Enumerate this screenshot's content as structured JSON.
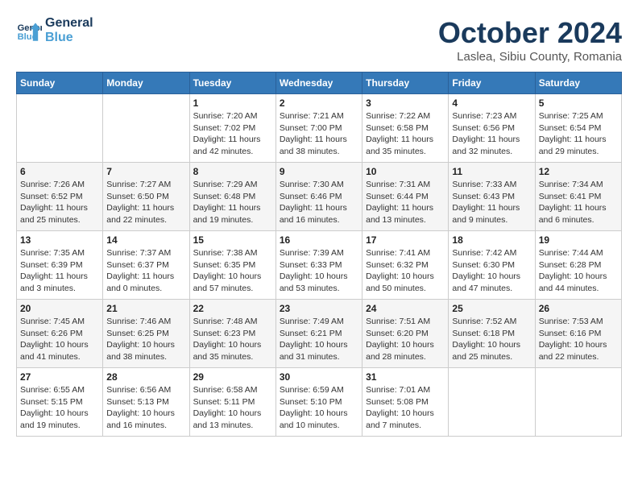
{
  "header": {
    "logo_line1": "General",
    "logo_line2": "Blue",
    "month": "October 2024",
    "location": "Laslea, Sibiu County, Romania"
  },
  "weekdays": [
    "Sunday",
    "Monday",
    "Tuesday",
    "Wednesday",
    "Thursday",
    "Friday",
    "Saturday"
  ],
  "weeks": [
    [
      {
        "day": "",
        "info": ""
      },
      {
        "day": "",
        "info": ""
      },
      {
        "day": "1",
        "info": "Sunrise: 7:20 AM\nSunset: 7:02 PM\nDaylight: 11 hours and 42 minutes."
      },
      {
        "day": "2",
        "info": "Sunrise: 7:21 AM\nSunset: 7:00 PM\nDaylight: 11 hours and 38 minutes."
      },
      {
        "day": "3",
        "info": "Sunrise: 7:22 AM\nSunset: 6:58 PM\nDaylight: 11 hours and 35 minutes."
      },
      {
        "day": "4",
        "info": "Sunrise: 7:23 AM\nSunset: 6:56 PM\nDaylight: 11 hours and 32 minutes."
      },
      {
        "day": "5",
        "info": "Sunrise: 7:25 AM\nSunset: 6:54 PM\nDaylight: 11 hours and 29 minutes."
      }
    ],
    [
      {
        "day": "6",
        "info": "Sunrise: 7:26 AM\nSunset: 6:52 PM\nDaylight: 11 hours and 25 minutes."
      },
      {
        "day": "7",
        "info": "Sunrise: 7:27 AM\nSunset: 6:50 PM\nDaylight: 11 hours and 22 minutes."
      },
      {
        "day": "8",
        "info": "Sunrise: 7:29 AM\nSunset: 6:48 PM\nDaylight: 11 hours and 19 minutes."
      },
      {
        "day": "9",
        "info": "Sunrise: 7:30 AM\nSunset: 6:46 PM\nDaylight: 11 hours and 16 minutes."
      },
      {
        "day": "10",
        "info": "Sunrise: 7:31 AM\nSunset: 6:44 PM\nDaylight: 11 hours and 13 minutes."
      },
      {
        "day": "11",
        "info": "Sunrise: 7:33 AM\nSunset: 6:43 PM\nDaylight: 11 hours and 9 minutes."
      },
      {
        "day": "12",
        "info": "Sunrise: 7:34 AM\nSunset: 6:41 PM\nDaylight: 11 hours and 6 minutes."
      }
    ],
    [
      {
        "day": "13",
        "info": "Sunrise: 7:35 AM\nSunset: 6:39 PM\nDaylight: 11 hours and 3 minutes."
      },
      {
        "day": "14",
        "info": "Sunrise: 7:37 AM\nSunset: 6:37 PM\nDaylight: 11 hours and 0 minutes."
      },
      {
        "day": "15",
        "info": "Sunrise: 7:38 AM\nSunset: 6:35 PM\nDaylight: 10 hours and 57 minutes."
      },
      {
        "day": "16",
        "info": "Sunrise: 7:39 AM\nSunset: 6:33 PM\nDaylight: 10 hours and 53 minutes."
      },
      {
        "day": "17",
        "info": "Sunrise: 7:41 AM\nSunset: 6:32 PM\nDaylight: 10 hours and 50 minutes."
      },
      {
        "day": "18",
        "info": "Sunrise: 7:42 AM\nSunset: 6:30 PM\nDaylight: 10 hours and 47 minutes."
      },
      {
        "day": "19",
        "info": "Sunrise: 7:44 AM\nSunset: 6:28 PM\nDaylight: 10 hours and 44 minutes."
      }
    ],
    [
      {
        "day": "20",
        "info": "Sunrise: 7:45 AM\nSunset: 6:26 PM\nDaylight: 10 hours and 41 minutes."
      },
      {
        "day": "21",
        "info": "Sunrise: 7:46 AM\nSunset: 6:25 PM\nDaylight: 10 hours and 38 minutes."
      },
      {
        "day": "22",
        "info": "Sunrise: 7:48 AM\nSunset: 6:23 PM\nDaylight: 10 hours and 35 minutes."
      },
      {
        "day": "23",
        "info": "Sunrise: 7:49 AM\nSunset: 6:21 PM\nDaylight: 10 hours and 31 minutes."
      },
      {
        "day": "24",
        "info": "Sunrise: 7:51 AM\nSunset: 6:20 PM\nDaylight: 10 hours and 28 minutes."
      },
      {
        "day": "25",
        "info": "Sunrise: 7:52 AM\nSunset: 6:18 PM\nDaylight: 10 hours and 25 minutes."
      },
      {
        "day": "26",
        "info": "Sunrise: 7:53 AM\nSunset: 6:16 PM\nDaylight: 10 hours and 22 minutes."
      }
    ],
    [
      {
        "day": "27",
        "info": "Sunrise: 6:55 AM\nSunset: 5:15 PM\nDaylight: 10 hours and 19 minutes."
      },
      {
        "day": "28",
        "info": "Sunrise: 6:56 AM\nSunset: 5:13 PM\nDaylight: 10 hours and 16 minutes."
      },
      {
        "day": "29",
        "info": "Sunrise: 6:58 AM\nSunset: 5:11 PM\nDaylight: 10 hours and 13 minutes."
      },
      {
        "day": "30",
        "info": "Sunrise: 6:59 AM\nSunset: 5:10 PM\nDaylight: 10 hours and 10 minutes."
      },
      {
        "day": "31",
        "info": "Sunrise: 7:01 AM\nSunset: 5:08 PM\nDaylight: 10 hours and 7 minutes."
      },
      {
        "day": "",
        "info": ""
      },
      {
        "day": "",
        "info": ""
      }
    ]
  ]
}
